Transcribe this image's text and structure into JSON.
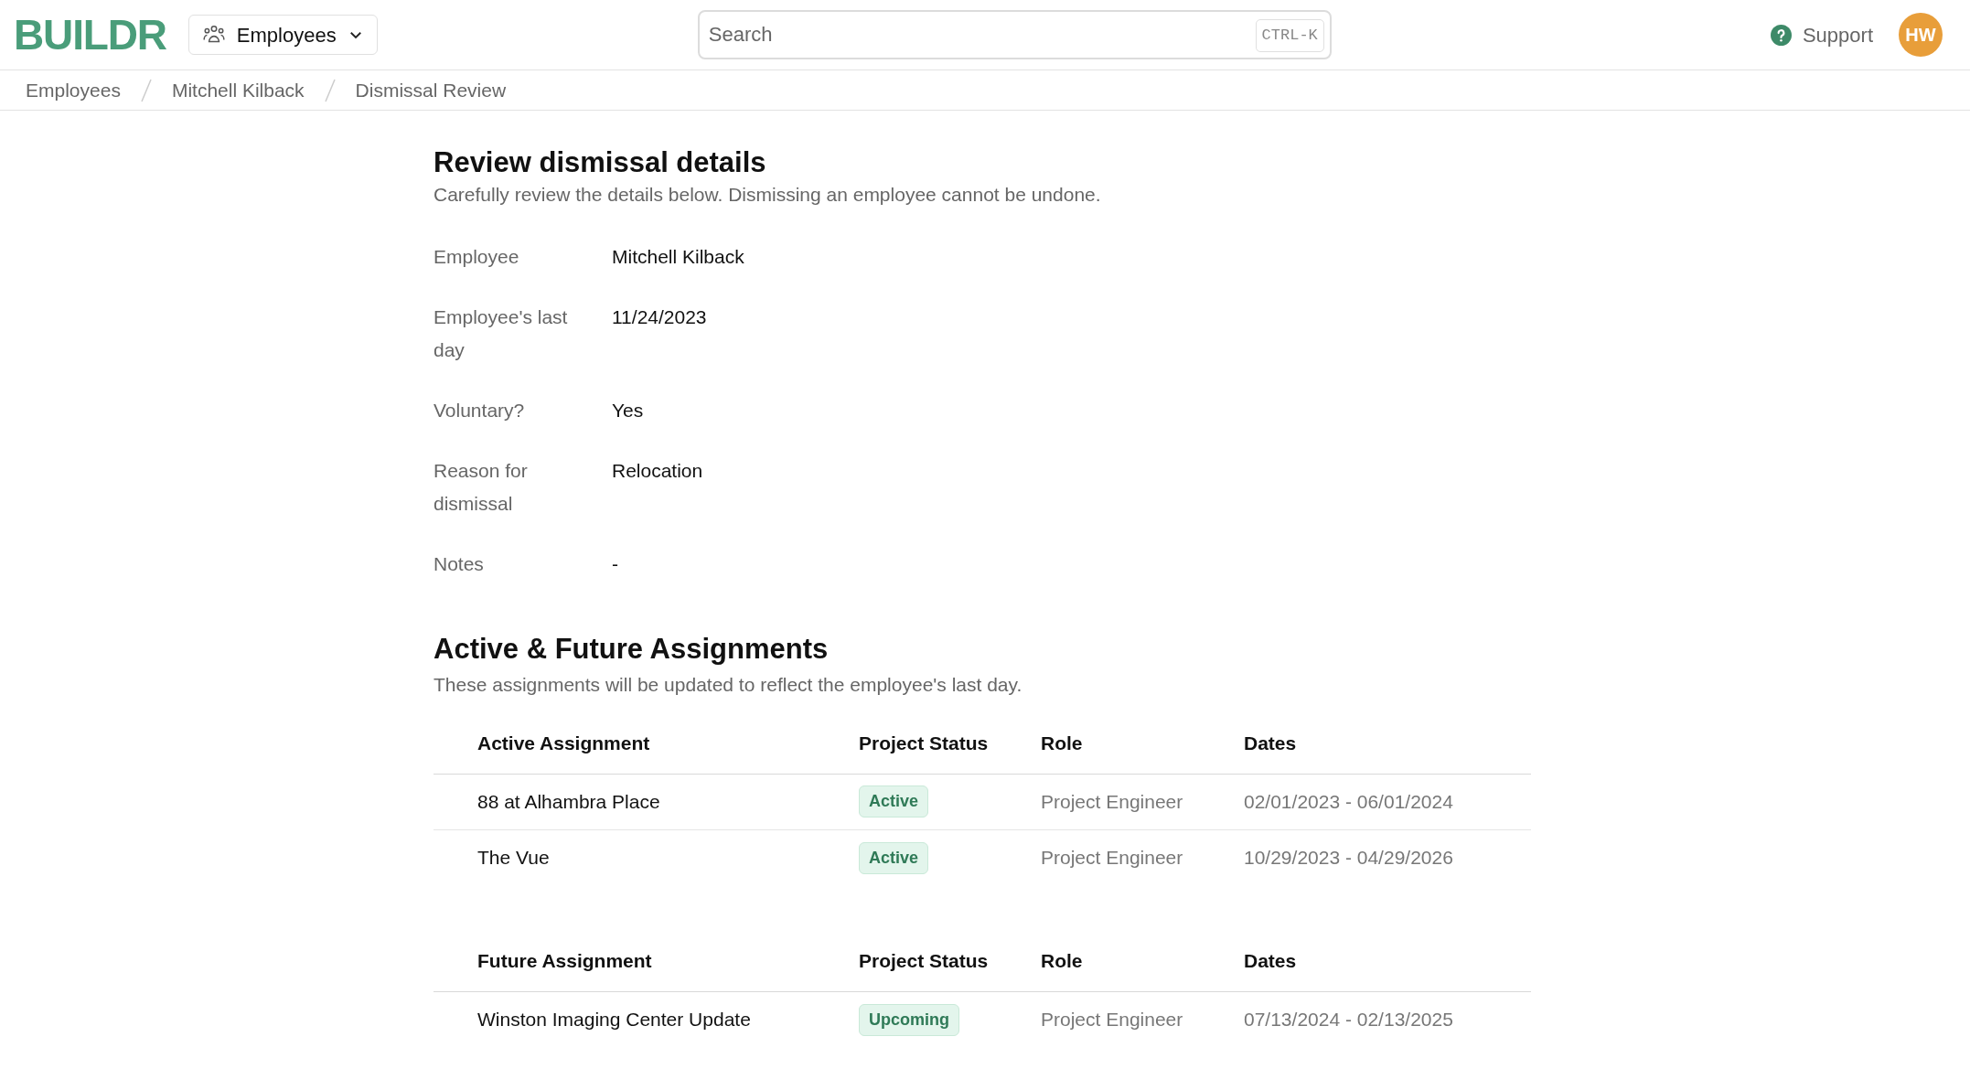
{
  "header": {
    "logo": "BUILDR",
    "module_menu": {
      "label": "Employees"
    },
    "search": {
      "placeholder": "Search",
      "shortcut": "CTRL-K"
    },
    "support": "Support",
    "avatar": "HW"
  },
  "breadcrumbs": [
    "Employees",
    "Mitchell Kilback",
    "Dismissal Review"
  ],
  "review": {
    "title": "Review dismissal details",
    "subtitle": "Carefully review the details below. Dismissing an employee cannot be undone.",
    "details": [
      {
        "label": "Employee",
        "value": "Mitchell Kilback"
      },
      {
        "label": "Employee's last day",
        "value": "11/24/2023"
      },
      {
        "label": "Voluntary?",
        "value": "Yes"
      },
      {
        "label": "Reason for dismissal",
        "value": "Relocation"
      },
      {
        "label": "Notes",
        "value": "-"
      }
    ]
  },
  "assignments": {
    "title": "Active & Future Assignments",
    "subtitle": "These assignments will be updated to reflect the employee's last day.",
    "tables": [
      {
        "columns": [
          "Active Assignment",
          "Project Status",
          "Role",
          "Dates"
        ],
        "rows": [
          {
            "name": "88 at Alhambra Place",
            "status": "Active",
            "role": "Project Engineer",
            "dates": "02/01/2023 - 06/01/2024"
          },
          {
            "name": "The Vue",
            "status": "Active",
            "role": "Project Engineer",
            "dates": "10/29/2023 - 04/29/2026"
          }
        ]
      },
      {
        "columns": [
          "Future Assignment",
          "Project Status",
          "Role",
          "Dates"
        ],
        "rows": [
          {
            "name": "Winston Imaging Center Update",
            "status": "Upcoming",
            "role": "Project Engineer",
            "dates": "07/13/2024 - 02/13/2025"
          }
        ]
      }
    ]
  }
}
